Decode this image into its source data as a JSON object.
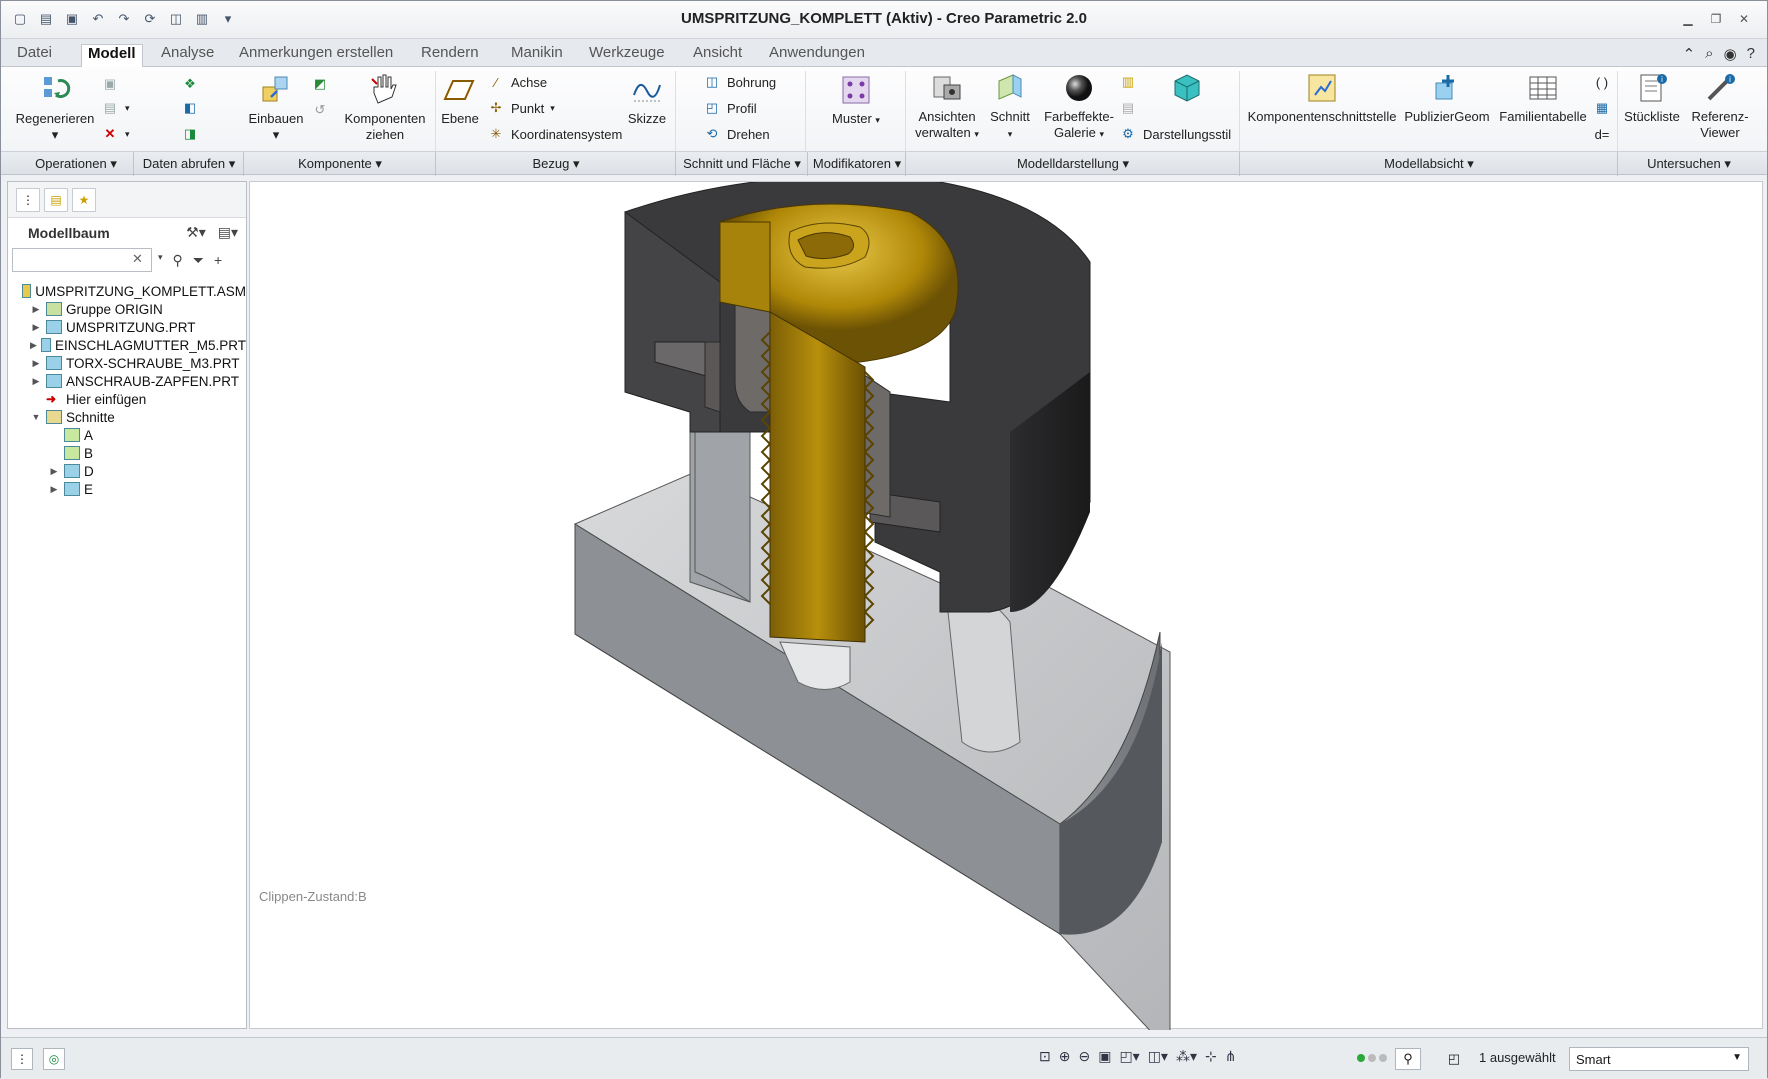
{
  "window": {
    "title": "UMSPRITZUNG_KOMPLETT (Aktiv) - Creo Parametric 2.0"
  },
  "tabs": [
    "Datei",
    "Modell",
    "Analyse",
    "Anmerkungen erstellen",
    "Rendern",
    "Manikin",
    "Werkzeuge",
    "Ansicht",
    "Anwendungen"
  ],
  "active_tab": "Modell",
  "ribbon": {
    "regenerieren": "Regenerieren",
    "einbauen": "Einbauen",
    "komponenten_ziehen_1": "Komponenten",
    "komponenten_ziehen_2": "ziehen",
    "ebene": "Ebene",
    "achse": "Achse",
    "punkt": "Punkt",
    "koordinatensystem": "Koordinatensystem",
    "skizze": "Skizze",
    "bohrung": "Bohrung",
    "profil": "Profil",
    "drehen": "Drehen",
    "muster": "Muster",
    "ansichten_1": "Ansichten",
    "ansichten_2": "verwalten",
    "schnitt": "Schnitt",
    "farbeffekte_1": "Farbeffekte-",
    "farbeffekte_2": "Galerie",
    "darstellungsstil": "Darstellungsstil",
    "komponentenschnittstelle": "Komponentenschnittstelle",
    "publiziergeom": "PublizierGeom",
    "familientabelle": "Familientabelle",
    "stueckliste": "Stückliste",
    "referenz_1": "Referenz-",
    "referenz_2": "Viewer",
    "d_eq": "d="
  },
  "groups": [
    "Operationen",
    "Daten abrufen",
    "Komponente",
    "Bezug",
    "Schnitt und Fläche",
    "Modifikatoren",
    "Modelldarstellung",
    "Modellabsicht",
    "Untersuchen"
  ],
  "model_tree": {
    "header": "Modellbaum",
    "search_value": "",
    "items": [
      {
        "label": "UMSPRITZUNG_KOMPLETT.ASM",
        "level": 0,
        "toggle": ""
      },
      {
        "label": "Gruppe ORIGIN",
        "level": 1,
        "toggle": "▶"
      },
      {
        "label": "UMSPRITZUNG.PRT",
        "level": 1,
        "toggle": "▶"
      },
      {
        "label": "EINSCHLAGMUTTER_M5.PRT",
        "level": 1,
        "toggle": "▶"
      },
      {
        "label": "TORX-SCHRAUBE_M3.PRT",
        "level": 1,
        "toggle": "▶"
      },
      {
        "label": "ANSCHRAUB-ZAPFEN.PRT",
        "level": 1,
        "toggle": "▶"
      },
      {
        "label": "Hier einfügen",
        "level": 1,
        "toggle": ""
      },
      {
        "label": "Schnitte",
        "level": 1,
        "toggle": "▼"
      },
      {
        "label": "A",
        "level": 2,
        "toggle": ""
      },
      {
        "label": "B",
        "level": 2,
        "toggle": ""
      },
      {
        "label": "D",
        "level": 2,
        "toggle": "▶"
      },
      {
        "label": "E",
        "level": 2,
        "toggle": "▶"
      }
    ]
  },
  "viewport": {
    "clip_label": "Clippen-Zustand:B"
  },
  "status": {
    "selected": "1 ausgewählt",
    "filter": "Smart"
  },
  "colors": {
    "screw": "#b8900c",
    "housing_dark": "#3b3b3b",
    "base_light": "#c4c6c9"
  }
}
